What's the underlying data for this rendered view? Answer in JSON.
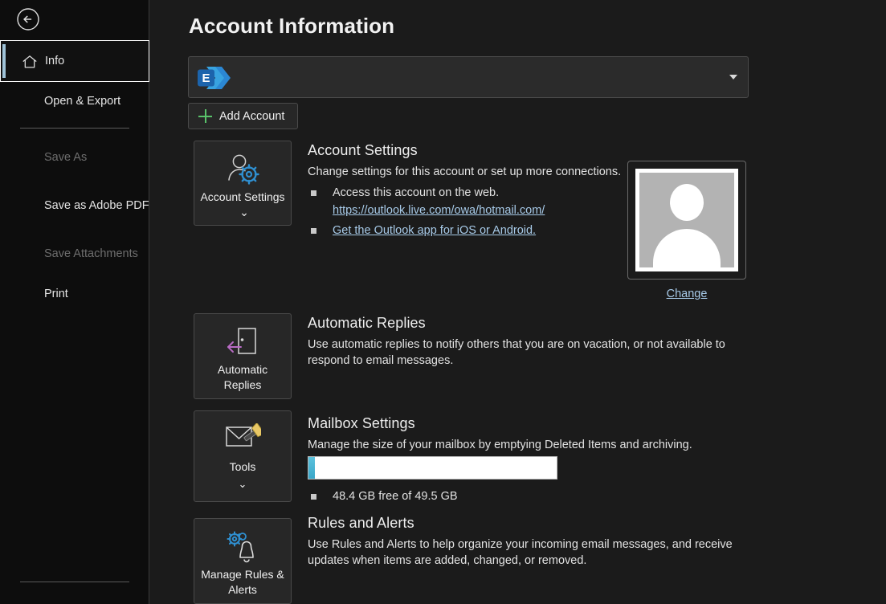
{
  "sidebar": {
    "back_icon": "back-arrow-icon",
    "items": [
      {
        "id": "info",
        "label": "Info",
        "icon": "home-icon",
        "selected": true,
        "disabled": false
      },
      {
        "id": "open-export",
        "label": "Open & Export",
        "selected": false,
        "disabled": false
      },
      {
        "id": "save-as",
        "label": "Save As",
        "selected": false,
        "disabled": true
      },
      {
        "id": "save-adobe-pdf",
        "label": "Save as Adobe PDF",
        "selected": false,
        "disabled": false
      },
      {
        "id": "save-attachments",
        "label": "Save Attachments",
        "selected": false,
        "disabled": true
      },
      {
        "id": "print",
        "label": "Print",
        "selected": false,
        "disabled": false
      }
    ]
  },
  "main": {
    "title": "Account Information",
    "account_selector": {
      "icon": "exchange-logo-icon",
      "primary_line": "",
      "secondary_line": "",
      "redacted": true,
      "caret_icon": "chevron-down-icon"
    },
    "add_account": {
      "label": "Add Account",
      "icon": "plus-icon"
    },
    "avatar": {
      "icon": "person-placeholder-avatar",
      "change_label": "Change"
    },
    "sections": [
      {
        "id": "account-settings",
        "button_label": "Account Settings",
        "button_icon": "person-gear-icon",
        "button_has_chevron": true,
        "heading": "Account Settings",
        "description": "Change settings for this account or set up more connections.",
        "bullets": [
          {
            "text": "Access this account on the web.",
            "link": null
          },
          {
            "text": null,
            "link": "https://outlook.live.com/owa/hotmail.com/",
            "indent": true
          },
          {
            "text": null,
            "link": "Get the Outlook app for iOS or Android."
          }
        ]
      },
      {
        "id": "automatic-replies",
        "button_label": "Automatic Replies",
        "button_icon": "door-arrow-out-icon",
        "button_has_chevron": false,
        "heading": "Automatic Replies",
        "description": "Use automatic replies to notify others that you are on vacation, or not available to respond to email messages.",
        "bullets": []
      },
      {
        "id": "mailbox-settings",
        "button_label": "Tools",
        "button_icon": "envelope-broom-icon",
        "button_has_chevron": true,
        "heading": "Mailbox Settings",
        "description": "Manage the size of your mailbox by emptying Deleted Items and archiving.",
        "storage": {
          "free_text": "48.4 GB free of 49.5 GB",
          "free_gb": 48.4,
          "total_gb": 49.5,
          "used_percent": 2,
          "fill_color": "#4bb4d4",
          "track_color": "#ffffff"
        }
      },
      {
        "id": "rules-and-alerts",
        "button_label": "Manage Rules & Alerts",
        "button_icon": "gears-bell-icon",
        "button_has_chevron": false,
        "heading": "Rules and Alerts",
        "description": "Use Rules and Alerts to help organize your incoming email messages, and receive updates when items are added, changed, or removed.",
        "bullets": []
      }
    ]
  },
  "colors": {
    "sidebar_bg": "#0d0d0d",
    "main_bg": "#1b1b1b",
    "button_bg": "#272727",
    "accent_link": "#a7cae8",
    "accent_selection": "#9fc3d8",
    "plus_green": "#59c26a",
    "storage_fill": "#4bb4d4"
  }
}
